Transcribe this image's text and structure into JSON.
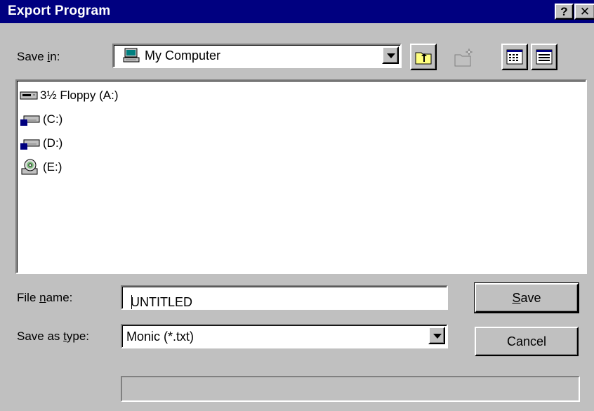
{
  "window": {
    "title": "Export Program"
  },
  "titlebar": {
    "help_label": "?",
    "close_label": "✕"
  },
  "save_in": {
    "label_pre": "Save ",
    "label_accel": "i",
    "label_post": "n:",
    "selected": "My Computer",
    "icon": "computer-icon"
  },
  "toolbar": {
    "up_one_level": "up-folder-icon",
    "create_new_folder": "new-folder-icon",
    "list_view": "list-view-icon",
    "details_view": "details-view-icon"
  },
  "files": [
    {
      "label": "3½ Floppy (A:)",
      "icon": "floppy-drive-icon"
    },
    {
      "label": "(C:)",
      "icon": "hard-drive-icon"
    },
    {
      "label": "(D:)",
      "icon": "hard-drive-icon"
    },
    {
      "label": "(E:)",
      "icon": "cd-drive-icon"
    }
  ],
  "file_name": {
    "label_pre": "File ",
    "label_accel": "n",
    "label_post": "ame:",
    "value": "UNTITLED"
  },
  "save_as_type": {
    "label_pre": "Save as ",
    "label_accel": "t",
    "label_post": "ype:",
    "selected": "Monic (*.txt)"
  },
  "buttons": {
    "save_accel": "S",
    "save_rest": "ave",
    "cancel": "Cancel"
  },
  "colors": {
    "titlebar": "#000080",
    "face": "#c0c0c0",
    "field": "#ffffff"
  }
}
